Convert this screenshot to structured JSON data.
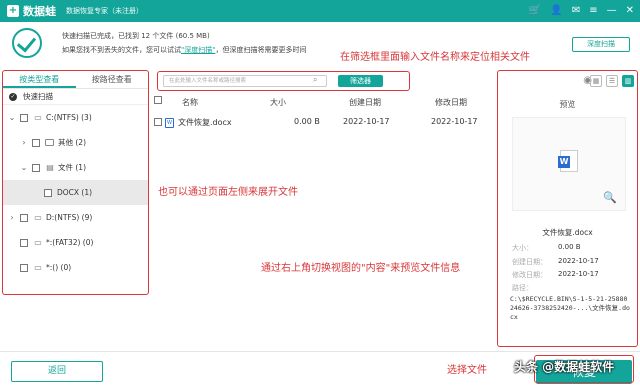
{
  "titlebar": {
    "app_name": "数据蛙",
    "subtitle": "数据恢复专家（未注册）",
    "icons": [
      "cart-icon",
      "user-icon",
      "email-icon",
      "menu-icon",
      "minimize-icon",
      "close-icon"
    ]
  },
  "status": {
    "line1": "快速扫描已完成，已找到 12 个文件 (60.5 MB)",
    "line2_prefix": "如果您找不到丢失的文件，您可以试试",
    "line2_link": "\"深度扫描\"",
    "line2_suffix": "，但深度扫描将需要更多时间",
    "deep_scan_button": "深度扫描"
  },
  "left": {
    "tabs": [
      "按类型查看",
      "按路径查看"
    ],
    "quick_scan": "快速扫描",
    "tree": [
      {
        "label": "C:(NTFS) (3)",
        "arrow": "⌄",
        "indent": 0,
        "kind": "drive"
      },
      {
        "label": "其他 (2)",
        "arrow": "›",
        "indent": 1,
        "kind": "folder"
      },
      {
        "label": "文件 (1)",
        "arrow": "⌄",
        "indent": 1,
        "kind": "file"
      },
      {
        "label": "DOCX (1)",
        "arrow": "",
        "indent": 2,
        "kind": "none"
      },
      {
        "label": "D:(NTFS) (9)",
        "arrow": "›",
        "indent": 0,
        "kind": "drive"
      },
      {
        "label": "*:(FAT32) (0)",
        "arrow": "",
        "indent": 0,
        "kind": "drive"
      },
      {
        "label": "*:() (0)",
        "arrow": "",
        "indent": 0,
        "kind": "drive"
      }
    ]
  },
  "search": {
    "placeholder": "在此处输入文件名称或路径搜索",
    "filter_button": "筛选器"
  },
  "table": {
    "headers": {
      "name": "名称",
      "size": "大小",
      "created": "创建日期",
      "modified": "修改日期"
    },
    "rows": [
      {
        "name": "文件恢复.docx",
        "size": "0.00  B",
        "created": "2022-10-17",
        "modified": "2022-10-17"
      }
    ]
  },
  "preview": {
    "title": "预览",
    "file_name": "文件恢复.docx",
    "fields": [
      {
        "label": "大小：",
        "value": "0.00  B"
      },
      {
        "label": "创建日期：",
        "value": "2022-10-17"
      },
      {
        "label": "修改日期：",
        "value": "2022-10-17"
      },
      {
        "label": "路径：",
        "value": ""
      }
    ],
    "path": "C:\\$RECYCLE.BIN\\S-1-5-21-2588024626-3738252420-...\\文件恢复.docx"
  },
  "bottom": {
    "back_button": "返回",
    "recover_button": "恢复"
  },
  "annotations": {
    "search": "在筛选框里面输入文件名称来定位相关文件",
    "left": "也可以通过页面左侧来展开文件",
    "preview": "通过右上角切换视图的\"内容\"来预览文件信息",
    "recover": "选择文件"
  },
  "watermark": "头条 @数据蛙软件",
  "colors": {
    "accent": "#13a59a",
    "annotation": "#d9373a"
  }
}
